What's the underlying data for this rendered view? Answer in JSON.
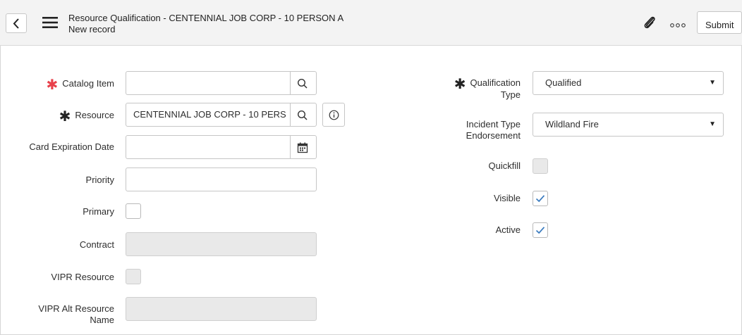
{
  "header": {
    "title": "Resource Qualification - CENTENNIAL JOB CORP - 10 PERSON A",
    "subtitle": "New record",
    "submit_label": "Submit"
  },
  "form": {
    "catalog_item": {
      "label": "Catalog Item",
      "value": ""
    },
    "resource": {
      "label": "Resource",
      "value": "CENTENNIAL JOB CORP - 10 PERS"
    },
    "card_expiration_date": {
      "label": "Card Expiration Date",
      "value": ""
    },
    "priority": {
      "label": "Priority",
      "value": ""
    },
    "primary": {
      "label": "Primary",
      "checked": false
    },
    "contract": {
      "label": "Contract",
      "value": ""
    },
    "vipr_resource": {
      "label": "VIPR Resource",
      "checked": false
    },
    "vipr_alt_resource_name": {
      "label_line1": "VIPR Alt Resource",
      "label_line2": "Name",
      "value": ""
    },
    "qualification_type": {
      "label_line1": "Qualification",
      "label_line2": "Type",
      "value": "Qualified"
    },
    "incident_type_endorsement": {
      "label_line1": "Incident Type",
      "label_line2": "Endorsement",
      "value": "Wildland Fire"
    },
    "quickfill": {
      "label": "Quickfill",
      "checked": false
    },
    "visible": {
      "label": "Visible",
      "checked": true
    },
    "active": {
      "label": "Active",
      "checked": true
    }
  },
  "colors": {
    "required_red": "#e8404a",
    "check_blue": "#3a7bbf",
    "readonly_bg": "#e9e9e9"
  }
}
